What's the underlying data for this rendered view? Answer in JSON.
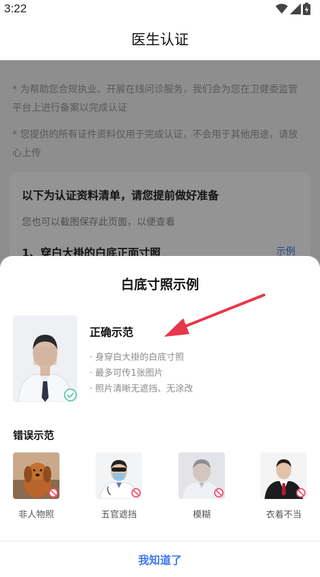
{
  "status_bar": {
    "time": "3:22"
  },
  "nav": {
    "title": "医生认证"
  },
  "page": {
    "note1": "* 为帮助您合规执业、开展在线问诊服务，我们会为您在卫健委监管平台上进行备案以完成认证",
    "note2": "* 您提供的所有证件资料仅用于完成认证，不会用于其他用途，请放心上传",
    "card": {
      "title": "以下为认证资料清单，请您提前做好准备",
      "subtitle": "您也可以截图保存此页面，以便查看",
      "item1": "1、穿白大褂的白底正面寸照",
      "example_link": "示例"
    }
  },
  "sheet": {
    "title": "白底寸照示例",
    "correct": {
      "title": "正确示范",
      "rules": [
        "· 身穿白大褂的白底寸照",
        "· 最多可传1张图片",
        "· 照片清晰无遮挡、无涂改"
      ]
    },
    "wrong": {
      "title": "错误示范",
      "items": [
        {
          "label": "非人物照"
        },
        {
          "label": "五官遮挡"
        },
        {
          "label": "模糊"
        },
        {
          "label": "衣着不当"
        }
      ]
    },
    "confirm_label": "我知道了"
  },
  "colors": {
    "accent": "#3f78f0",
    "arrow": "#e8364a",
    "overlay": "rgba(0,0,0,0.42)"
  }
}
